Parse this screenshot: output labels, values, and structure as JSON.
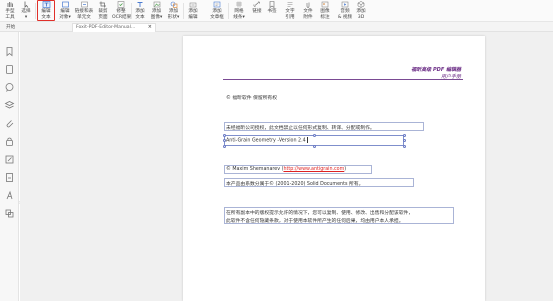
{
  "toolbar": {
    "tools": [
      {
        "id": "hand",
        "line1": "手型",
        "line2": "工具"
      },
      {
        "id": "select",
        "line1": "选择",
        "line2": "▾"
      },
      {
        "id": "edit-text",
        "line1": "编辑",
        "line2": "文本"
      },
      {
        "id": "edit-object",
        "line1": "编辑",
        "line2": "对象▾"
      },
      {
        "id": "link-edit",
        "line1": "链接和表",
        "line2": "单元文"
      },
      {
        "id": "crop",
        "line1": "裁剪",
        "line2": "页面"
      },
      {
        "id": "fix-ocr",
        "line1": "修整",
        "line2": "OCR结果"
      },
      {
        "id": "add-text",
        "line1": "添加",
        "line2": "文本"
      },
      {
        "id": "add-image",
        "line1": "添加",
        "line2": "图像▾"
      },
      {
        "id": "add-shape",
        "line1": "添加",
        "line2": "形状▾"
      },
      {
        "id": "typewriter",
        "line1": "添加",
        "line2": "编辑"
      },
      {
        "id": "add-textbox",
        "line1": "添加",
        "line2": "文章框"
      },
      {
        "id": "form-field",
        "line1": "网格",
        "line2": "线条▾"
      },
      {
        "id": "link",
        "line1": "链接",
        "line2": ""
      },
      {
        "id": "watermark",
        "line1": "书签",
        "line2": ""
      },
      {
        "id": "text-ref",
        "line1": "文字",
        "line2": "引用"
      },
      {
        "id": "attach",
        "line1": "文件",
        "line2": "附件"
      },
      {
        "id": "image-mark",
        "line1": "图像",
        "line2": "标注"
      },
      {
        "id": "audio-video",
        "line1": "音频",
        "line2": "& 视频"
      },
      {
        "id": "add-3d",
        "line1": "添加",
        "line2": "3D"
      }
    ]
  },
  "tabs": {
    "open_label": "开始",
    "document_tab": "Foxit-PDF-Editor-Manual...",
    "close": "×"
  },
  "document": {
    "header_title": "福昕高级 PDF 编辑器",
    "header_subtitle": "用户手册",
    "copyright_heading": "© 福昕软件 保留所有权",
    "para1": "未经福昕公司授权，此文档禁止以任何形式复制、转译、分配或制作。",
    "para2": "Anti-Grain Geometry -Version 2.4",
    "para3_prefix": "© Maxim Shemanarev (",
    "para3_link": "http://www.antigrain.com",
    "para3_suffix": ")",
    "para4": "本产品由系数分属于© (2001-2020) Solid Documents 所有。",
    "para5_line1": "在所有副本中的版权提示允许的情况下，您可以复制、使用、修改、出售和分配该软件，",
    "para5_line2": "此软件不含任何隐藏条款，对于使用本软件所产生的任何后果，均由用户本人承担。"
  },
  "colors": {
    "active_outline": "#e0302a",
    "header_purple": "#6c2e86",
    "link_red": "#dd2222",
    "box_border": "#aab4d6"
  }
}
